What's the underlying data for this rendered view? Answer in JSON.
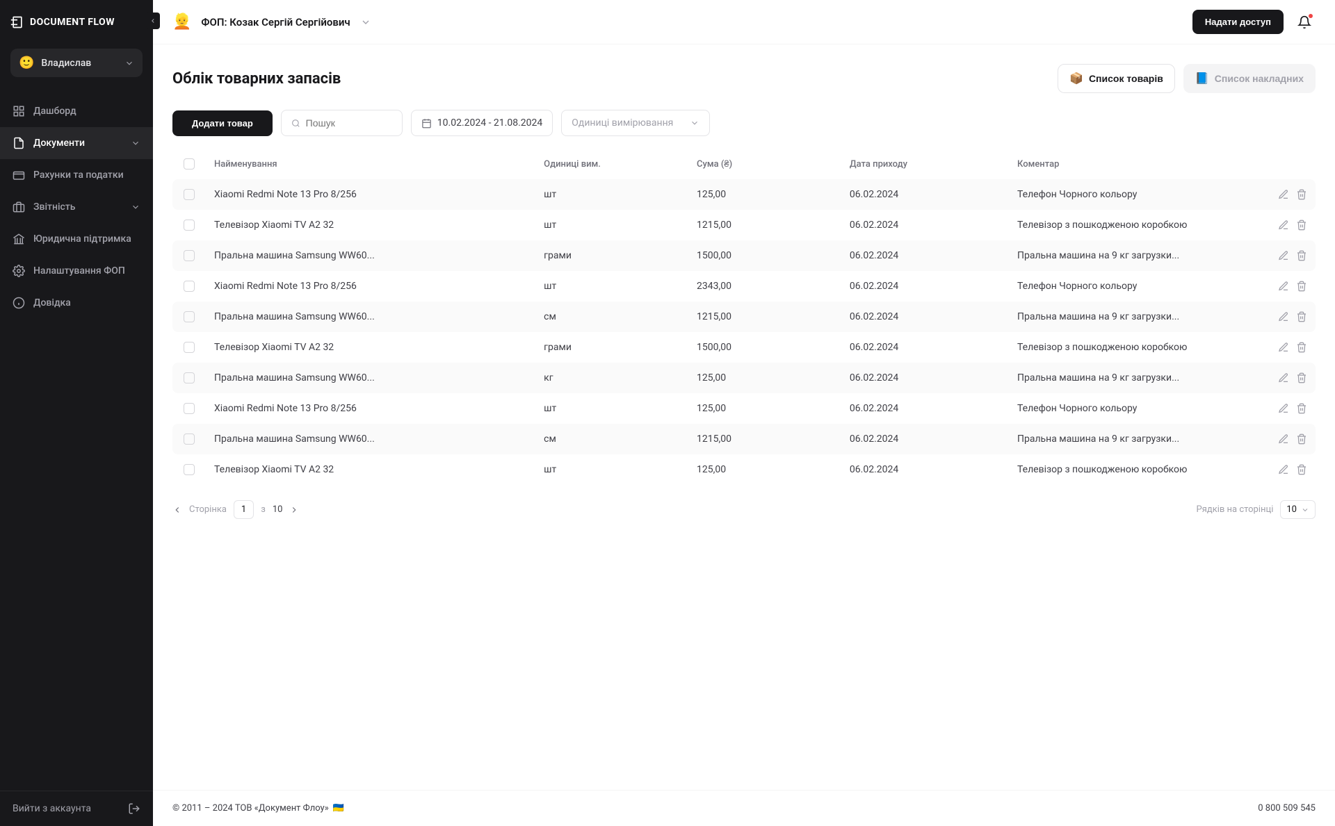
{
  "brand": "DOCUMENT FLOW",
  "user": {
    "emoji": "🙂",
    "name": "Владислав"
  },
  "nav": {
    "dashboard": "Дашборд",
    "documents": "Документи",
    "accounts": "Рахунки та податки",
    "reports": "Звітність",
    "legal": "Юридична підтримка",
    "settings": "Налаштування ФОП",
    "help": "Довідка"
  },
  "logout": "Вийти з аккаунта",
  "topbar": {
    "org_emoji": "👱",
    "org_name": "ФОП: Козак Сергій Сергійович",
    "grant_access": "Надати доступ"
  },
  "page": {
    "title": "Облік товарних запасів",
    "tab_goods": "Список товарів",
    "tab_invoices": "Список накладних"
  },
  "toolbar": {
    "add": "Додати товар",
    "search_placeholder": "Пошук",
    "date_range": "10.02.2024 - 21.08.2024",
    "units_placeholder": "Одиниці вимірювання"
  },
  "table": {
    "headers": {
      "name": "Найменування",
      "units": "Одиниці вим.",
      "sum": "Сума (₴)",
      "date": "Дата приходу",
      "comment": "Коментар"
    },
    "rows": [
      {
        "name": "Xiaomi Redmi Note 13 Pro 8/256",
        "unit": "шт",
        "sum": "125,00",
        "date": "06.02.2024",
        "comment": "Телефон Чорного кольору"
      },
      {
        "name": "Телевізор Xiaomi TV A2 32",
        "unit": "шт",
        "sum": "1215,00",
        "date": "06.02.2024",
        "comment": "Телевізор з пошкодженою коробкою"
      },
      {
        "name": "Пральна машина Samsung WW60...",
        "unit": "грами",
        "sum": "1500,00",
        "date": "06.02.2024",
        "comment": "Пральна машина на 9 кг загрузки..."
      },
      {
        "name": "Xiaomi Redmi Note 13 Pro 8/256",
        "unit": "шт",
        "sum": "2343,00",
        "date": "06.02.2024",
        "comment": "Телефон Чорного кольору"
      },
      {
        "name": "Пральна машина Samsung WW60...",
        "unit": "см",
        "sum": "1215,00",
        "date": "06.02.2024",
        "comment": "Пральна машина на 9 кг загрузки..."
      },
      {
        "name": "Телевізор Xiaomi TV A2 32",
        "unit": "грами",
        "sum": "1500,00",
        "date": "06.02.2024",
        "comment": "Телевізор з пошкодженою коробкою"
      },
      {
        "name": "Пральна машина Samsung WW60...",
        "unit": "кг",
        "sum": "125,00",
        "date": "06.02.2024",
        "comment": "Пральна машина на 9 кг загрузки..."
      },
      {
        "name": "Xiaomi Redmi Note 13 Pro 8/256",
        "unit": "шт",
        "sum": "125,00",
        "date": "06.02.2024",
        "comment": "Телефон Чорного кольору"
      },
      {
        "name": "Пральна машина Samsung WW60...",
        "unit": "см",
        "sum": "1215,00",
        "date": "06.02.2024",
        "comment": "Пральна машина на 9 кг загрузки..."
      },
      {
        "name": "Телевізор Xiaomi TV A2 32",
        "unit": "шт",
        "sum": "125,00",
        "date": "06.02.2024",
        "comment": "Телевізор з пошкодженою коробкою"
      }
    ]
  },
  "pager": {
    "page_label": "Сторінка",
    "current": "1",
    "of": "з",
    "total": "10",
    "rows_label": "Рядків на сторінці",
    "rows_value": "10"
  },
  "footer": {
    "copyright": "© 2011 – 2024 ТОВ «Документ Флоу»",
    "flag": "🇺🇦",
    "phone": "0 800 509 545"
  }
}
